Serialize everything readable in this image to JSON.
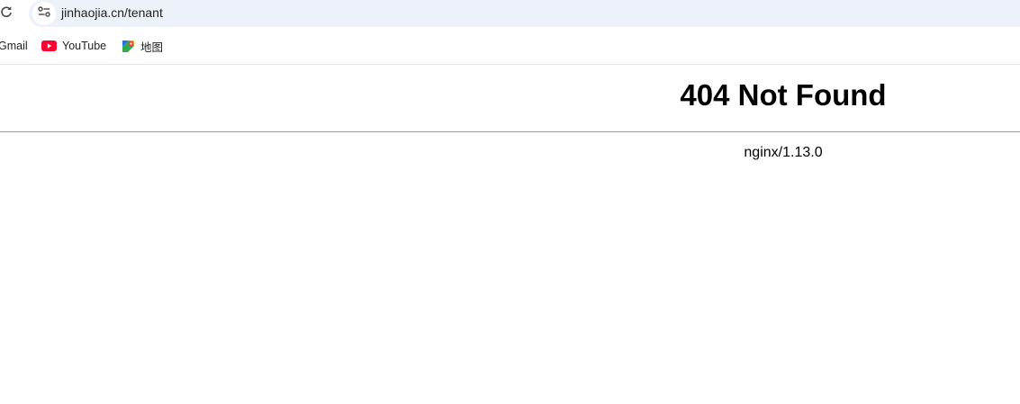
{
  "browser": {
    "url": "jinhaojia.cn/tenant",
    "bookmarks": [
      {
        "label": "Gmail",
        "icon": "gmail-icon"
      },
      {
        "label": "YouTube",
        "icon": "youtube-icon"
      },
      {
        "label": "地图",
        "icon": "maps-icon"
      }
    ]
  },
  "page": {
    "title": "404 Not Found",
    "server": "nginx/1.13.0"
  },
  "colors": {
    "omnibox_bg": "#edf2fa",
    "youtube_red": "#ff0033",
    "divider": "#9e9e9e"
  }
}
